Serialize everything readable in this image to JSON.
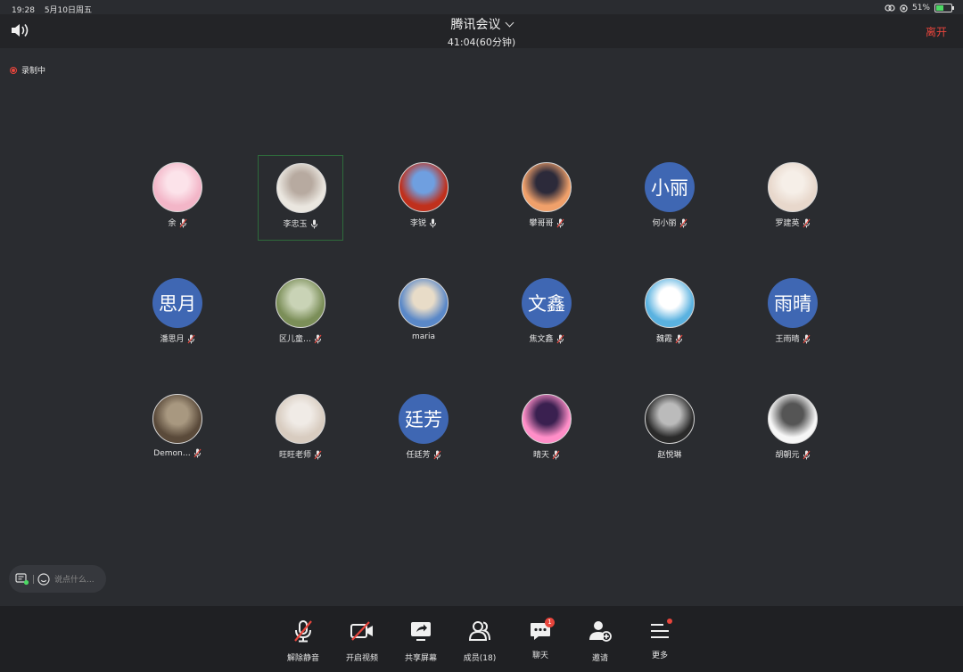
{
  "status": {
    "time": "19:28",
    "date": "5月10日周五",
    "battery": "51%",
    "battery_level": 0.51
  },
  "header": {
    "title": "腾讯会议",
    "timer": "41:04(60分钟)",
    "leave": "离开"
  },
  "recording": {
    "label": "录制中",
    "color": "#e8453c"
  },
  "participants": [
    {
      "name": "余",
      "initials": "",
      "muted": true
    },
    {
      "name": "李忠玉",
      "initials": "",
      "muted": false,
      "active": true
    },
    {
      "name": "李锐",
      "initials": "",
      "muted": false
    },
    {
      "name": "攀哥哥",
      "initials": "",
      "muted": true
    },
    {
      "name": "何小丽",
      "initials": "小丽",
      "muted": true
    },
    {
      "name": "罗建英",
      "initials": "",
      "muted": true
    },
    {
      "name": "潘思月",
      "initials": "思月",
      "muted": true
    },
    {
      "name": "区儿童…",
      "initials": "",
      "muted": true
    },
    {
      "name": "maria",
      "initials": "",
      "muted": null
    },
    {
      "name": "焦文鑫",
      "initials": "文鑫",
      "muted": true
    },
    {
      "name": "魏霞",
      "initials": "",
      "muted": true
    },
    {
      "name": "王雨晴",
      "initials": "雨晴",
      "muted": true
    },
    {
      "name": "Demon…",
      "initials": "",
      "muted": true
    },
    {
      "name": "旺旺老师",
      "initials": "",
      "muted": true
    },
    {
      "name": "任廷芳",
      "initials": "廷芳",
      "muted": true
    },
    {
      "name": "晴天",
      "initials": "",
      "muted": true
    },
    {
      "name": "赵悦琳",
      "initials": "",
      "muted": null
    },
    {
      "name": "胡朝元",
      "initials": "",
      "muted": true
    }
  ],
  "chat": {
    "placeholder": "说点什么..."
  },
  "toolbar": {
    "unmute": "解除静音",
    "start_video": "开启视频",
    "share_screen": "共享屏幕",
    "members": "成员(18)",
    "chat": "聊天",
    "chat_badge": "1",
    "invite": "邀请",
    "more": "更多"
  },
  "colors": {
    "accent_red": "#e8453c",
    "initials_bg": "#3f67b3",
    "active_border": "#2e6b3b"
  }
}
